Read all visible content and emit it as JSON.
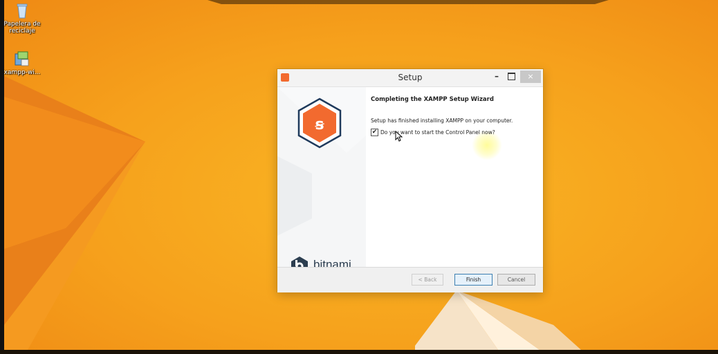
{
  "desktop": {
    "icons": [
      {
        "label": "Papelera de reciclaje",
        "icon": "recycle-bin-icon"
      },
      {
        "label": "xampp-wi...",
        "icon": "installer-icon"
      }
    ]
  },
  "dialog": {
    "title": "Setup",
    "window_controls": {
      "minimize": "–",
      "close": "×"
    },
    "heading": "Completing the XAMPP Setup Wizard",
    "message": "Setup has finished installing XAMPP on your computer.",
    "checkbox": {
      "label": "Do you want to start the Control Panel now?",
      "checked": true,
      "mark": "✔"
    },
    "brand": "bitnami",
    "buttons": {
      "back": "< Back",
      "finish": "Finish",
      "cancel": "Cancel"
    }
  },
  "colors": {
    "desktop_bg": "#f7a51e",
    "xampp_orange": "#f26a2f",
    "xampp_navy": "#1f3a5c",
    "finish_border": "#3c7fb1"
  }
}
